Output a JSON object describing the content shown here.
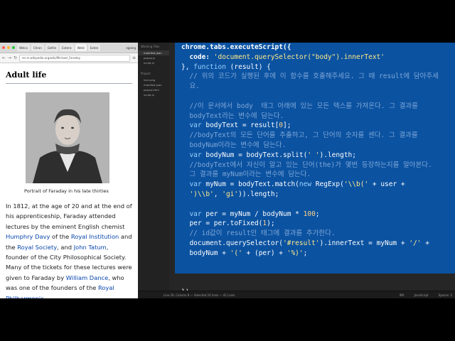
{
  "browser": {
    "tabs": [
      "Welco",
      "Chron",
      "Gettin",
      "Extens",
      "Work",
      "Exten"
    ],
    "user": "egoing",
    "url": "en.m.wikipedia.org/wiki/Michael_Faraday",
    "section_heading": "Adult life",
    "image_caption": "Portrait of Faraday in his late thirties",
    "paragraph": [
      {
        "t": "In 1812, at the age of 20 and at the end of his apprenticeship, Faraday attended lectures by the eminent English chemist "
      },
      {
        "t": "Humphry Davy",
        "link": true
      },
      {
        "t": " of the "
      },
      {
        "t": "Royal Institution",
        "link": true
      },
      {
        "t": " and the "
      },
      {
        "t": "Royal Society",
        "link": true
      },
      {
        "t": ", and "
      },
      {
        "t": "John Tatum",
        "link": true
      },
      {
        "t": ", founder of the City Philosophical Society. Many of the tickets for these lectures were given to Faraday by "
      },
      {
        "t": "William Dance",
        "link": true
      },
      {
        "t": ", who was one of the founders of the "
      },
      {
        "t": "Royal Philharmonic",
        "link": true
      }
    ]
  },
  "sidebar": {
    "open_files_label": "Working Files",
    "open_files": [
      "manifest.json",
      "popup.js",
      "script.js"
    ],
    "project_label": "Project",
    "project_files": [
      "icon.png",
      "manifest.json",
      "popup.html",
      "script.js"
    ]
  },
  "editor": {
    "lines": [
      [
        {
          "t": "chrome.tabs.executeScript({",
          "c": "f"
        }
      ],
      [
        {
          "t": "  code: ",
          "c": "k"
        },
        {
          "t": "'document.querySelector(\"body\").innerText'",
          "c": "s"
        }
      ],
      [
        {
          "t": "}, ",
          "c": ""
        },
        {
          "t": "function",
          "c": "kw"
        },
        {
          "t": " (result) {",
          "c": ""
        }
      ],
      [
        {
          "t": "  // 위의 코드가 실행된 후에 이 함수를 호출해주세요. 그 때 result에 담아주세",
          "c": "c"
        }
      ],
      [
        {
          "t": "  요.",
          "c": "c"
        }
      ],
      [
        {
          "t": "",
          "c": ""
        }
      ],
      [
        {
          "t": "  //이 문서에서 body  태그 아래에 있는 모든 텍스를 가져온다. 그 결과를",
          "c": "c"
        }
      ],
      [
        {
          "t": "  bodyText라는 변수에 담는다.",
          "c": "c"
        }
      ],
      [
        {
          "t": "  ",
          "c": ""
        },
        {
          "t": "var",
          "c": "kw"
        },
        {
          "t": " bodyText = result[",
          "c": ""
        },
        {
          "t": "0",
          "c": "n"
        },
        {
          "t": "];",
          "c": ""
        }
      ],
      [
        {
          "t": "  //bodyText의 모든 단어를 추출하고, 그 단어의 숫자를 센다. 그 결과를",
          "c": "c"
        }
      ],
      [
        {
          "t": "  bodyNum이라는 변수에 담는다.",
          "c": "c"
        }
      ],
      [
        {
          "t": "  ",
          "c": ""
        },
        {
          "t": "var",
          "c": "kw"
        },
        {
          "t": " bodyNum = bodyText.split(",
          "c": ""
        },
        {
          "t": "' '",
          "c": "s"
        },
        {
          "t": ").length;",
          "c": ""
        }
      ],
      [
        {
          "t": "  //bodyText에서 자신이 알고 있는 단어(the)가 몇번 등장하는지를 알아본다.",
          "c": "c"
        }
      ],
      [
        {
          "t": "  그 결과를 myNum이라는 변수에 담는다.",
          "c": "c"
        }
      ],
      [
        {
          "t": "  ",
          "c": ""
        },
        {
          "t": "var",
          "c": "kw"
        },
        {
          "t": " myNum = bodyText.match(",
          "c": ""
        },
        {
          "t": "new",
          "c": "kw"
        },
        {
          "t": " RegExp(",
          "c": ""
        },
        {
          "t": "'\\\\b('",
          "c": "s"
        },
        {
          "t": " + user +",
          "c": ""
        }
      ],
      [
        {
          "t": "  ",
          "c": ""
        },
        {
          "t": "')\\\\b'",
          "c": "s"
        },
        {
          "t": ", ",
          "c": ""
        },
        {
          "t": "'gi'",
          "c": "s"
        },
        {
          "t": ")).length;",
          "c": ""
        }
      ],
      [
        {
          "t": "",
          "c": ""
        }
      ],
      [
        {
          "t": "  ",
          "c": ""
        },
        {
          "t": "var",
          "c": "kw"
        },
        {
          "t": " per = myNum / bodyNum * ",
          "c": ""
        },
        {
          "t": "100",
          "c": "n"
        },
        {
          "t": ";",
          "c": ""
        }
      ],
      [
        {
          "t": "  per = per.toFixed(",
          "c": ""
        },
        {
          "t": "1",
          "c": "n"
        },
        {
          "t": ");",
          "c": ""
        }
      ],
      [
        {
          "t": "  // id값이 result인 태그에 결과를 추가한다.",
          "c": "c"
        }
      ],
      [
        {
          "t": "  document.querySelector(",
          "c": ""
        },
        {
          "t": "'#result'",
          "c": "s"
        },
        {
          "t": ").innerText = myNum + ",
          "c": ""
        },
        {
          "t": "'/'",
          "c": "s"
        },
        {
          "t": " +",
          "c": ""
        }
      ],
      [
        {
          "t": "  bodyNum + ",
          "c": ""
        },
        {
          "t": "'('",
          "c": "s"
        },
        {
          "t": " + (per) + ",
          "c": ""
        },
        {
          "t": "'%)'",
          "c": "s"
        },
        {
          "t": ";",
          "c": ""
        }
      ],
      [
        {
          "t": "",
          "c": ""
        }
      ],
      [
        {
          "t": "",
          "c": ""
        }
      ],
      [
        {
          "t": "  ",
          "c": ""
        },
        {
          "t": "",
          "c": ""
        }
      ],
      [
        {
          "t": "});",
          "c": ""
        }
      ],
      [
        {
          "t": "",
          "c": ""
        }
      ],
      [
        {
          "t": "});",
          "c": ""
        }
      ]
    ]
  },
  "status": {
    "left": "Line 26, Column 8 — Selected 24 lines — 41 Lines",
    "ins": "INS",
    "lang": "JavaScript",
    "spaces": "Spaces: 2"
  }
}
